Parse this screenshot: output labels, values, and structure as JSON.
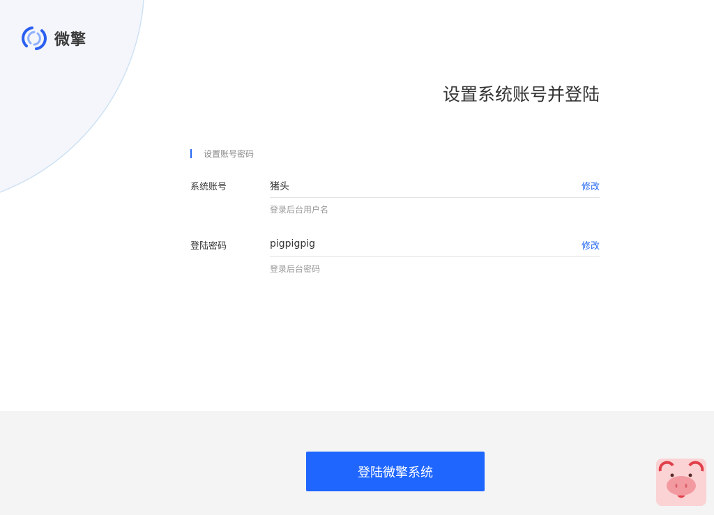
{
  "brand": {
    "name": "微擎",
    "accent": "#1f66ff"
  },
  "page": {
    "title": "设置系统账号并登陆"
  },
  "section": {
    "title": "设置账号密码"
  },
  "fields": [
    {
      "label": "系统账号",
      "value": "猪头",
      "hint": "登录后台用户名",
      "action": "修改"
    },
    {
      "label": "登陆密码",
      "value": "pigpigpig",
      "hint": "登录后台密码",
      "action": "修改"
    }
  ],
  "footer": {
    "submit_label": "登陆微擎系统"
  }
}
